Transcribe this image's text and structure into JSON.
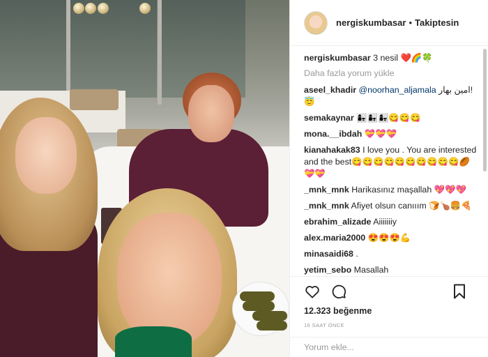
{
  "post": {
    "username": "nergiskumbasar",
    "separator": "•",
    "follow_label": "Takiptesin",
    "caption": {
      "user": "nergiskumbasar",
      "text": "3 nesil ❤️🌈🍀"
    },
    "load_more_label": "Daha fazla yorum yükle",
    "comments": [
      {
        "user": "aseel_khadir",
        "mention": "@noorhan_aljamala",
        "text": "امين بهار! 😇"
      },
      {
        "user": "semakaynar",
        "text": "👩‍👧👩‍👧👩‍👧😋😋😋"
      },
      {
        "user": "mona.__ibdah",
        "text": "💝💝💝"
      },
      {
        "user": "kianahakak83",
        "text": "I love you . You are interested and the best😋😋😋😋😋😋😋😋😋😋🏉💝💝"
      },
      {
        "user": "_mnk_mnk",
        "text": "Harikasınız maşallah 💖💖💖"
      },
      {
        "user": "_mnk_mnk",
        "text": "Afiyet olsun canııım 🍞🍗🍔🍕"
      },
      {
        "user": "ebrahim_alizade",
        "text": "Aiiiiiiiy"
      },
      {
        "user": "alex.maria2000",
        "text": "😍😍😍💪"
      },
      {
        "user": "minasaidi68",
        "text": "."
      },
      {
        "user": "yetim_sebo",
        "text": "Masallah"
      }
    ],
    "likes_count": "12.323",
    "likes_label": "beğenme",
    "time_ago": "16 SAAT ÖNCE",
    "comment_placeholder": "Yorum ekle..."
  },
  "icons": {
    "like": "heart-outline",
    "comment": "speech-bubble-outline",
    "save": "bookmark-outline"
  }
}
